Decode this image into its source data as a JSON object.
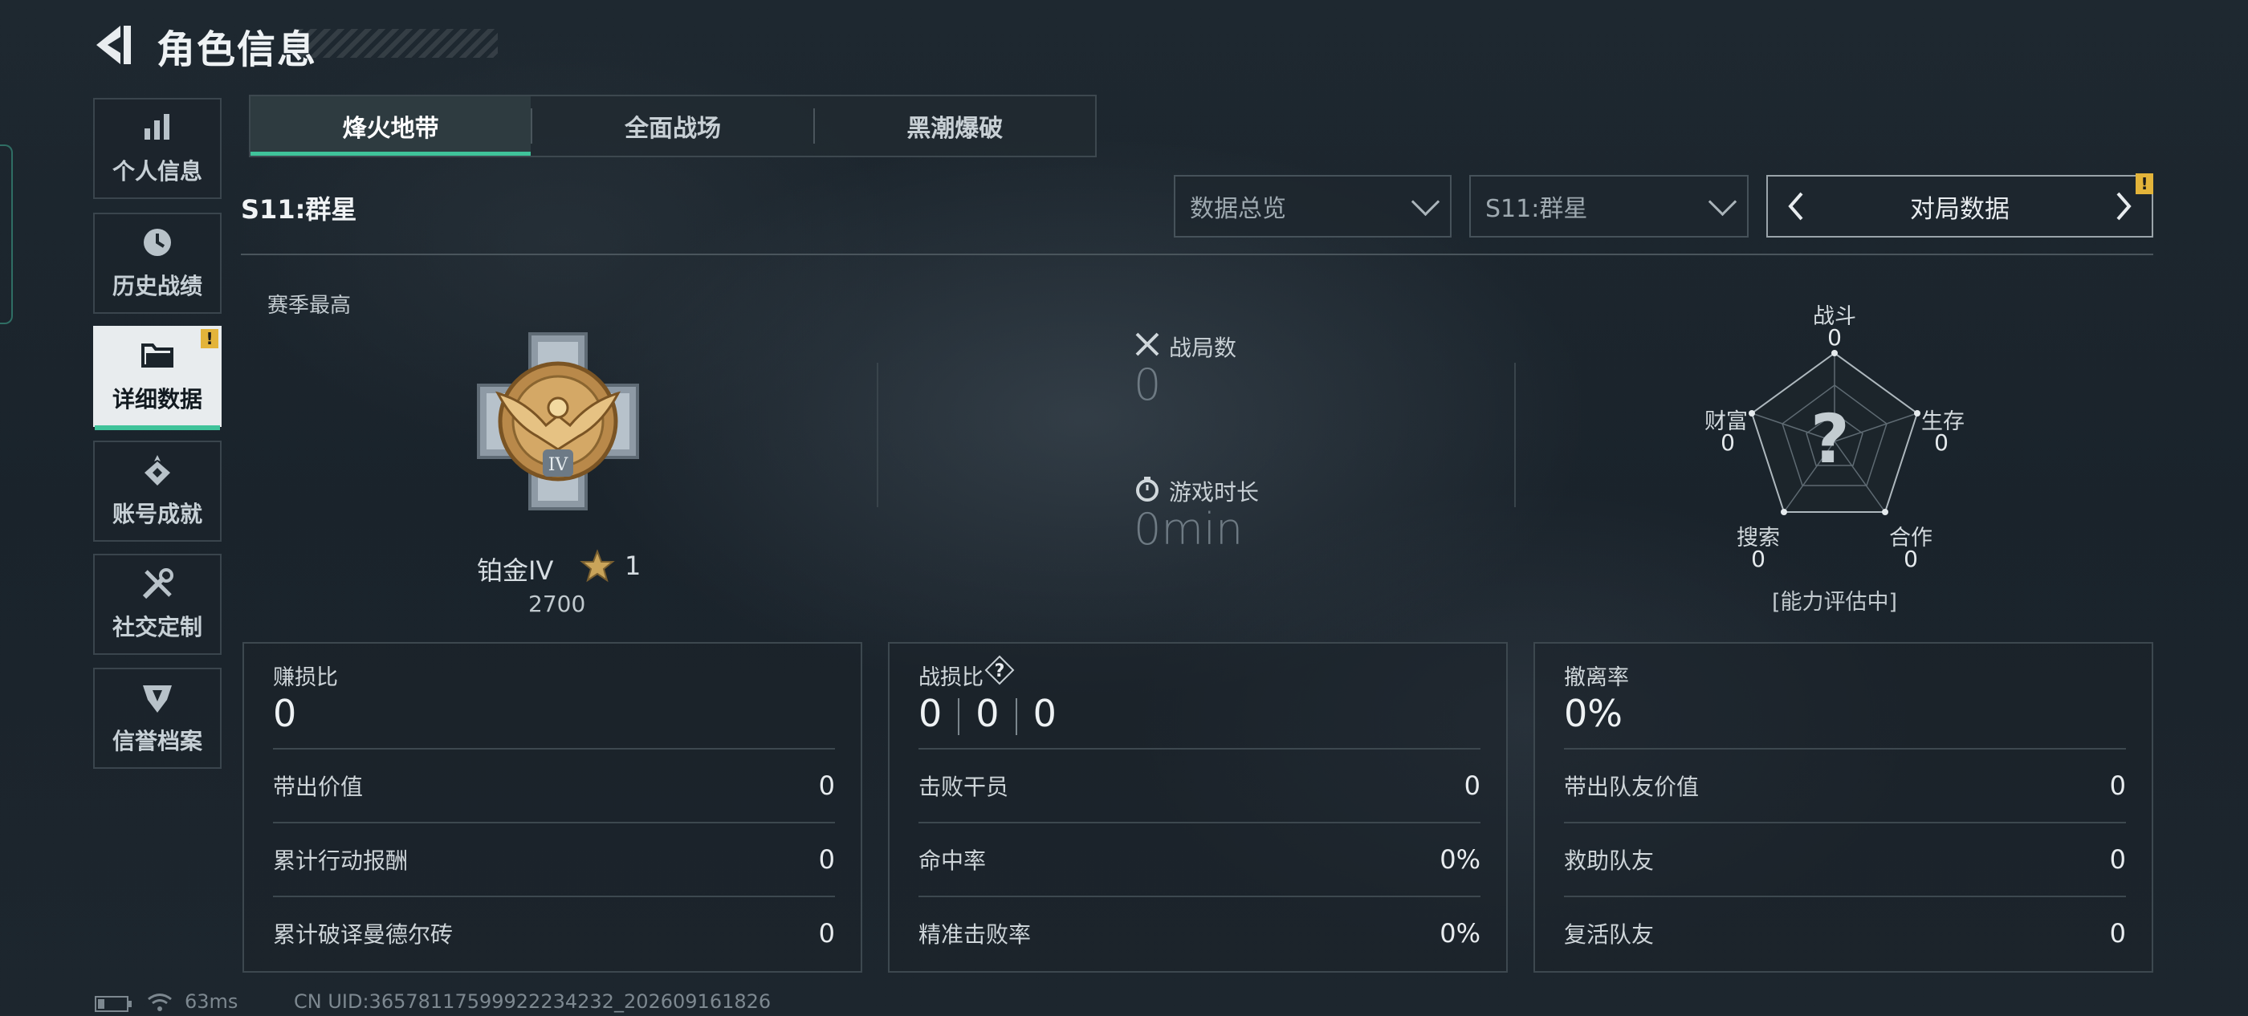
{
  "header": {
    "title": "角色信息"
  },
  "sidebar": {
    "items": [
      {
        "label": "个人信息",
        "icon": "bar-chart-icon"
      },
      {
        "label": "历史战绩",
        "icon": "clock-icon"
      },
      {
        "label": "详细数据",
        "icon": "folder-icon",
        "active": true,
        "badge": "!"
      },
      {
        "label": "账号成就",
        "icon": "medal-icon"
      },
      {
        "label": "社交定制",
        "icon": "tools-icon"
      },
      {
        "label": "信誉档案",
        "icon": "shield-icon"
      }
    ]
  },
  "tabs": [
    {
      "label": "烽火地带",
      "active": true
    },
    {
      "label": "全面战场"
    },
    {
      "label": "黑潮爆破"
    }
  ],
  "season_title": "S11:群星",
  "filters": {
    "view_select": "数据总览",
    "season_select": "S11:群星",
    "pager_label": "对局数据",
    "pager_badge": "!"
  },
  "season_high": {
    "label": "赛季最高",
    "rank_name": "铂金IV",
    "stars": "1",
    "score": "2700"
  },
  "match_stats": {
    "battles_label": "战局数",
    "battles_value": "0",
    "playtime_label": "游戏时长",
    "playtime_value": "0min"
  },
  "radar": {
    "center": "?",
    "axes": [
      {
        "label": "战斗",
        "value": "0"
      },
      {
        "label": "生存",
        "value": "0"
      },
      {
        "label": "合作",
        "value": "0"
      },
      {
        "label": "搜索",
        "value": "0"
      },
      {
        "label": "财富",
        "value": "0"
      }
    ],
    "note": "[能力评估中]"
  },
  "panels": [
    {
      "title": "赚损比",
      "big": "0",
      "rows": [
        {
          "k": "带出价值",
          "v": "0"
        },
        {
          "k": "累计行动报酬",
          "v": "0"
        },
        {
          "k": "累计破译曼德尔砖",
          "v": "0"
        }
      ]
    },
    {
      "title": "战损比",
      "big_parts": [
        "0",
        "0",
        "0"
      ],
      "rows": [
        {
          "k": "击败干员",
          "v": "0"
        },
        {
          "k": "命中率",
          "v": "0%"
        },
        {
          "k": "精准击败率",
          "v": "0%"
        }
      ]
    },
    {
      "title": "撤离率",
      "big": "0%",
      "rows": [
        {
          "k": "带出队友价值",
          "v": "0"
        },
        {
          "k": "救助队友",
          "v": "0"
        },
        {
          "k": "复活队友",
          "v": "0"
        }
      ]
    }
  ],
  "status_bar": {
    "ping": "63ms",
    "uid": "CN UID:365781175999222342​32_202609161826"
  },
  "colors": {
    "accent": "#3fc39a",
    "badge": "#e3b43a",
    "background": "#1b242c"
  }
}
